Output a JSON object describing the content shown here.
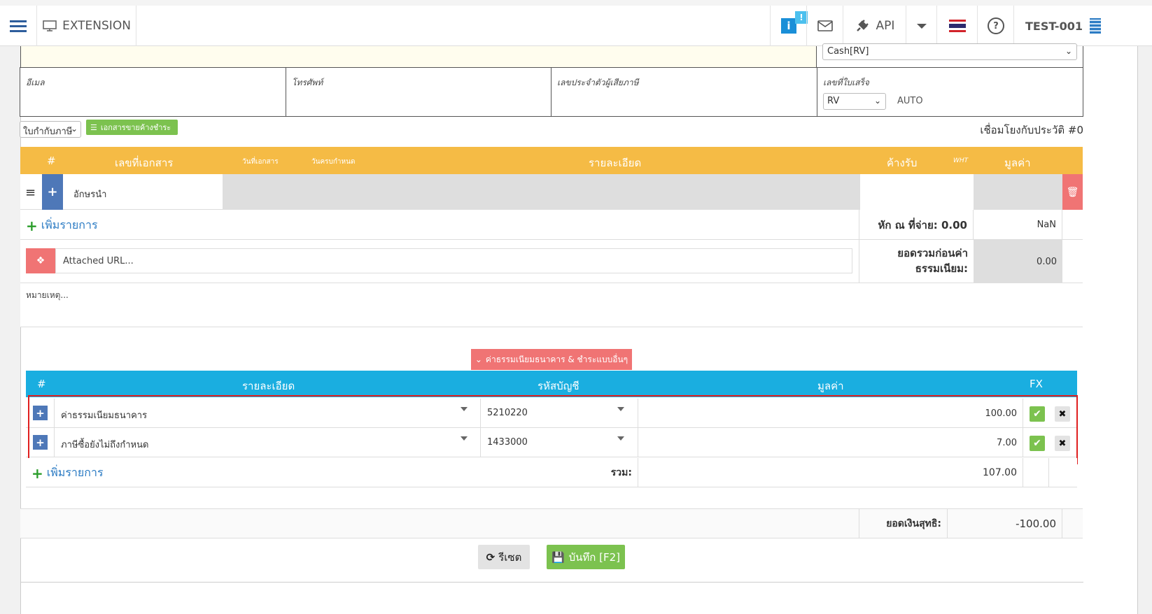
{
  "topbar": {
    "extension_label": "EXTENSION",
    "info_badge": "!",
    "api_label": "API",
    "user_code": "TEST-001"
  },
  "form": {
    "payment_select": "Cash[RV]",
    "email_label": "อีเมล",
    "phone_label": "โทรศัพท์",
    "taxid_label": "เลขประจำตัวผู้เสียภาษี",
    "receipt_no_label": "เลขที่ใบเสร็จ",
    "receipt_prefix": "RV",
    "receipt_auto": "AUTO",
    "doc_type_select": "ใบกำกับภาษี",
    "outstanding_button": "เอกสารขายค้างชำระ",
    "history_link": "เชื่อมโยงกับประวัติ #0"
  },
  "items_table": {
    "headers": {
      "num": "#",
      "doc_no": "เลขที่เอกสาร",
      "doc_date": "วันที่เอกสาร",
      "due_date": "วันครบกำหนด",
      "detail": "รายละเอียด",
      "receivable": "ค้างรับ",
      "wht": "WHT",
      "value": "มูลค่า"
    },
    "row_placeholder": "อักษรนำ",
    "add_item": "เพิ่มรายการ",
    "withholding_label": "หัก ณ ที่จ่าย: 0.00",
    "withholding_value": "NaN",
    "attached_placeholder": "Attached URL...",
    "subtotal_label": "ยอดรวมก่อนค่าธรรมเนียม:",
    "subtotal_value": "0.00",
    "note_placeholder": "หมายเหตุ..."
  },
  "fees": {
    "toggle_button": "ค่าธรรมเนียมธนาคาร & ชำระแบบอื่นๆ",
    "headers": {
      "num": "#",
      "detail": "รายละเอียด",
      "account": "รหัสบัญชี",
      "value": "มูลค่า",
      "fx": "FX"
    },
    "rows": [
      {
        "detail": "ค่าธรรมเนียมธนาคาร",
        "account": "5210220",
        "value": "100.00"
      },
      {
        "detail": "ภาษีซื้อยังไม่ถึงกำหนด",
        "account": "1433000",
        "value": "7.00"
      }
    ],
    "add_item": "เพิ่มรายการ",
    "total_label": "รวม:",
    "total_value": "107.00"
  },
  "summary": {
    "net_label": "ยอดเงินสุทธิ:",
    "net_value": "-100.00"
  },
  "actions": {
    "reset_label": "รีเซต",
    "save_label": "บันทึก [F2]"
  },
  "colors": {
    "orange_header": "#f5bb45",
    "blue_header": "#1aaee0",
    "green": "#7cc24f",
    "red_button": "#f07474",
    "highlight_red": "#e02020"
  }
}
